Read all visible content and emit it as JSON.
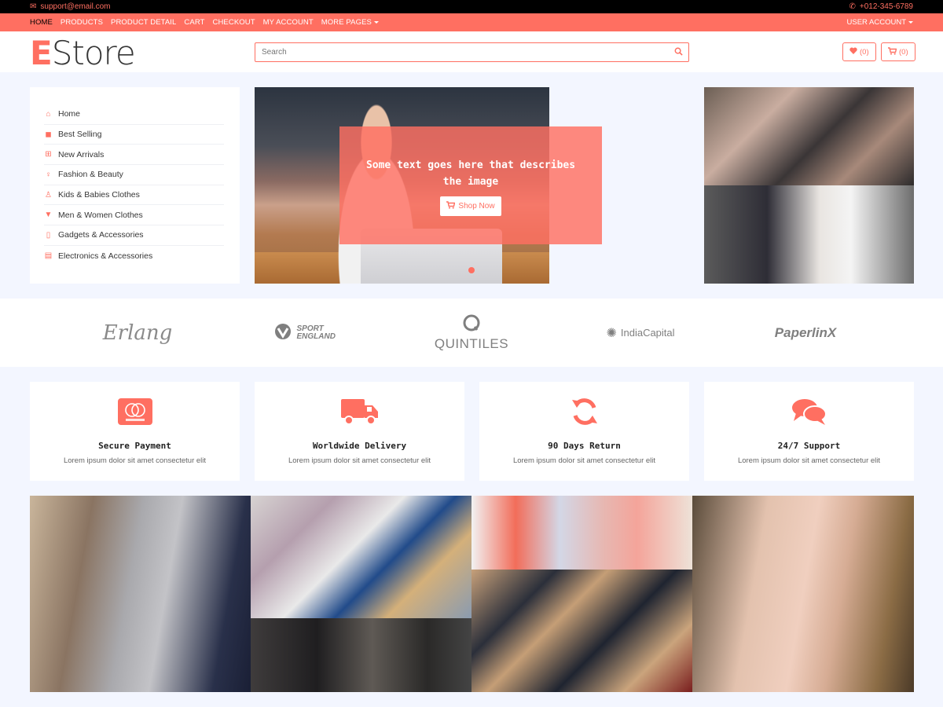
{
  "topbar": {
    "email": "support@email.com",
    "phone": "+012-345-6789"
  },
  "nav": {
    "items": [
      "HOME",
      "PRODUCTS",
      "PRODUCT DETAIL",
      "CART",
      "CHECKOUT",
      "MY ACCOUNT",
      "MORE PAGES"
    ],
    "active": "HOME",
    "account": "USER ACCOUNT"
  },
  "header": {
    "logo_initial": "E",
    "logo_rest": "Store",
    "search_placeholder": "Search",
    "wishlist_count": "(0)",
    "cart_count": "(0)"
  },
  "sidebar": {
    "items": [
      {
        "label": "Home",
        "icon": "home-icon"
      },
      {
        "label": "Best Selling",
        "icon": "shopping-bag-icon"
      },
      {
        "label": "New Arrivals",
        "icon": "plus-square-icon"
      },
      {
        "label": "Fashion & Beauty",
        "icon": "female-icon"
      },
      {
        "label": "Kids & Babies Clothes",
        "icon": "child-icon"
      },
      {
        "label": "Men & Women Clothes",
        "icon": "tshirt-icon"
      },
      {
        "label": "Gadgets & Accessories",
        "icon": "mobile-icon"
      },
      {
        "label": "Electronics & Accessories",
        "icon": "microchip-icon"
      }
    ]
  },
  "slider": {
    "caption": "Some text goes here that describes the image",
    "button": "Shop Now"
  },
  "brands": [
    "Erlang",
    "SPORT ENGLAND",
    "QUINTILES",
    "IndiaCapital",
    "PaperlinX"
  ],
  "features": [
    {
      "title": "Secure Payment",
      "desc": "Lorem ipsum dolor sit amet consectetur elit",
      "icon": "credit-card-icon"
    },
    {
      "title": "Worldwide Delivery",
      "desc": "Lorem ipsum dolor sit amet consectetur elit",
      "icon": "truck-icon"
    },
    {
      "title": "90 Days Return",
      "desc": "Lorem ipsum dolor sit amet consectetur elit",
      "icon": "sync-icon"
    },
    {
      "title": "24/7 Support",
      "desc": "Lorem ipsum dolor sit amet consectetur elit",
      "icon": "comments-icon"
    }
  ],
  "colors": {
    "accent": "#ff6f61",
    "page_bg": "#f3f6ff",
    "top_strip": "#000000"
  }
}
